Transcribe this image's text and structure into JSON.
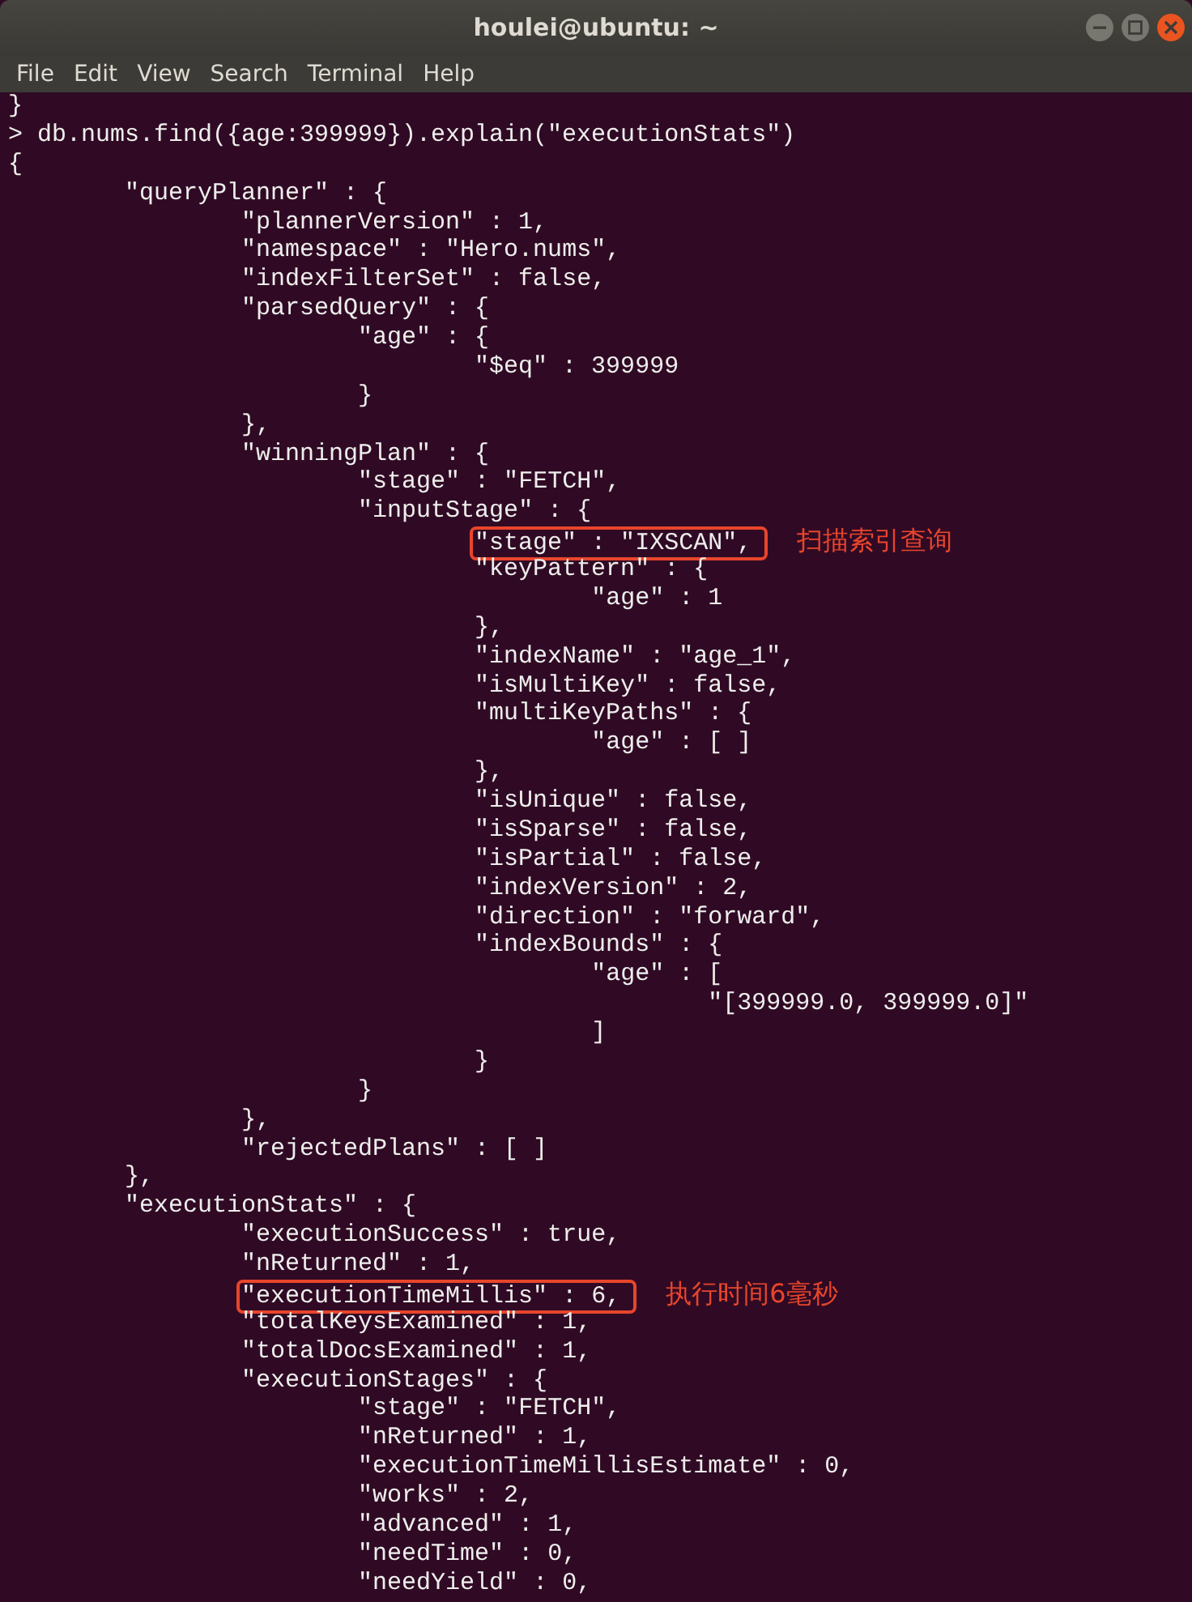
{
  "window": {
    "title": "houlei@ubuntu: ~"
  },
  "menu": [
    "File",
    "Edit",
    "View",
    "Search",
    "Terminal",
    "Help"
  ],
  "terminal_lines": [
    {
      "text": "}"
    },
    {
      "text": "> db.nums.find({age:399999}).explain(\"executionStats\")"
    },
    {
      "text": "{"
    },
    {
      "text": "\t\"queryPlanner\" : {"
    },
    {
      "text": "\t\t\"plannerVersion\" : 1,"
    },
    {
      "text": "\t\t\"namespace\" : \"Hero.nums\","
    },
    {
      "text": "\t\t\"indexFilterSet\" : false,"
    },
    {
      "text": "\t\t\"parsedQuery\" : {"
    },
    {
      "text": "\t\t\t\"age\" : {"
    },
    {
      "text": "\t\t\t\t\"$eq\" : 399999"
    },
    {
      "text": "\t\t\t}"
    },
    {
      "text": "\t\t},"
    },
    {
      "text": "\t\t\"winningPlan\" : {"
    },
    {
      "text": "\t\t\t\"stage\" : \"FETCH\","
    },
    {
      "text": "\t\t\t\"inputStage\" : {"
    },
    {
      "text": "\t\t\t\t\"stage\" : \"IXSCAN\",",
      "annotation": "扫描索引查询"
    },
    {
      "text": "\t\t\t\t\"keyPattern\" : {"
    },
    {
      "text": "\t\t\t\t\t\"age\" : 1"
    },
    {
      "text": "\t\t\t\t},"
    },
    {
      "text": "\t\t\t\t\"indexName\" : \"age_1\","
    },
    {
      "text": "\t\t\t\t\"isMultiKey\" : false,"
    },
    {
      "text": "\t\t\t\t\"multiKeyPaths\" : {"
    },
    {
      "text": "\t\t\t\t\t\"age\" : [ ]"
    },
    {
      "text": "\t\t\t\t},"
    },
    {
      "text": "\t\t\t\t\"isUnique\" : false,"
    },
    {
      "text": "\t\t\t\t\"isSparse\" : false,"
    },
    {
      "text": "\t\t\t\t\"isPartial\" : false,"
    },
    {
      "text": "\t\t\t\t\"indexVersion\" : 2,"
    },
    {
      "text": "\t\t\t\t\"direction\" : \"forward\","
    },
    {
      "text": "\t\t\t\t\"indexBounds\" : {"
    },
    {
      "text": "\t\t\t\t\t\"age\" : ["
    },
    {
      "text": "\t\t\t\t\t\t\"[399999.0, 399999.0]\""
    },
    {
      "text": "\t\t\t\t\t]"
    },
    {
      "text": "\t\t\t\t}"
    },
    {
      "text": "\t\t\t}"
    },
    {
      "text": "\t\t},"
    },
    {
      "text": "\t\t\"rejectedPlans\" : [ ]"
    },
    {
      "text": "\t},"
    },
    {
      "text": "\t\"executionStats\" : {"
    },
    {
      "text": "\t\t\"executionSuccess\" : true,"
    },
    {
      "text": "\t\t\"nReturned\" : 1,"
    },
    {
      "text": "\t\t\"executionTimeMillis\" : 6,",
      "annotation": "执行时间6毫秒"
    },
    {
      "text": "\t\t\"totalKeysExamined\" : 1,"
    },
    {
      "text": "\t\t\"totalDocsExamined\" : 1,"
    },
    {
      "text": "\t\t\"executionStages\" : {"
    },
    {
      "text": "\t\t\t\"stage\" : \"FETCH\","
    },
    {
      "text": "\t\t\t\"nReturned\" : 1,"
    },
    {
      "text": "\t\t\t\"executionTimeMillisEstimate\" : 0,"
    },
    {
      "text": "\t\t\t\"works\" : 2,"
    },
    {
      "text": "\t\t\t\"advanced\" : 1,"
    },
    {
      "text": "\t\t\t\"needTime\" : 0,"
    },
    {
      "text": "\t\t\t\"needYield\" : 0,"
    }
  ]
}
